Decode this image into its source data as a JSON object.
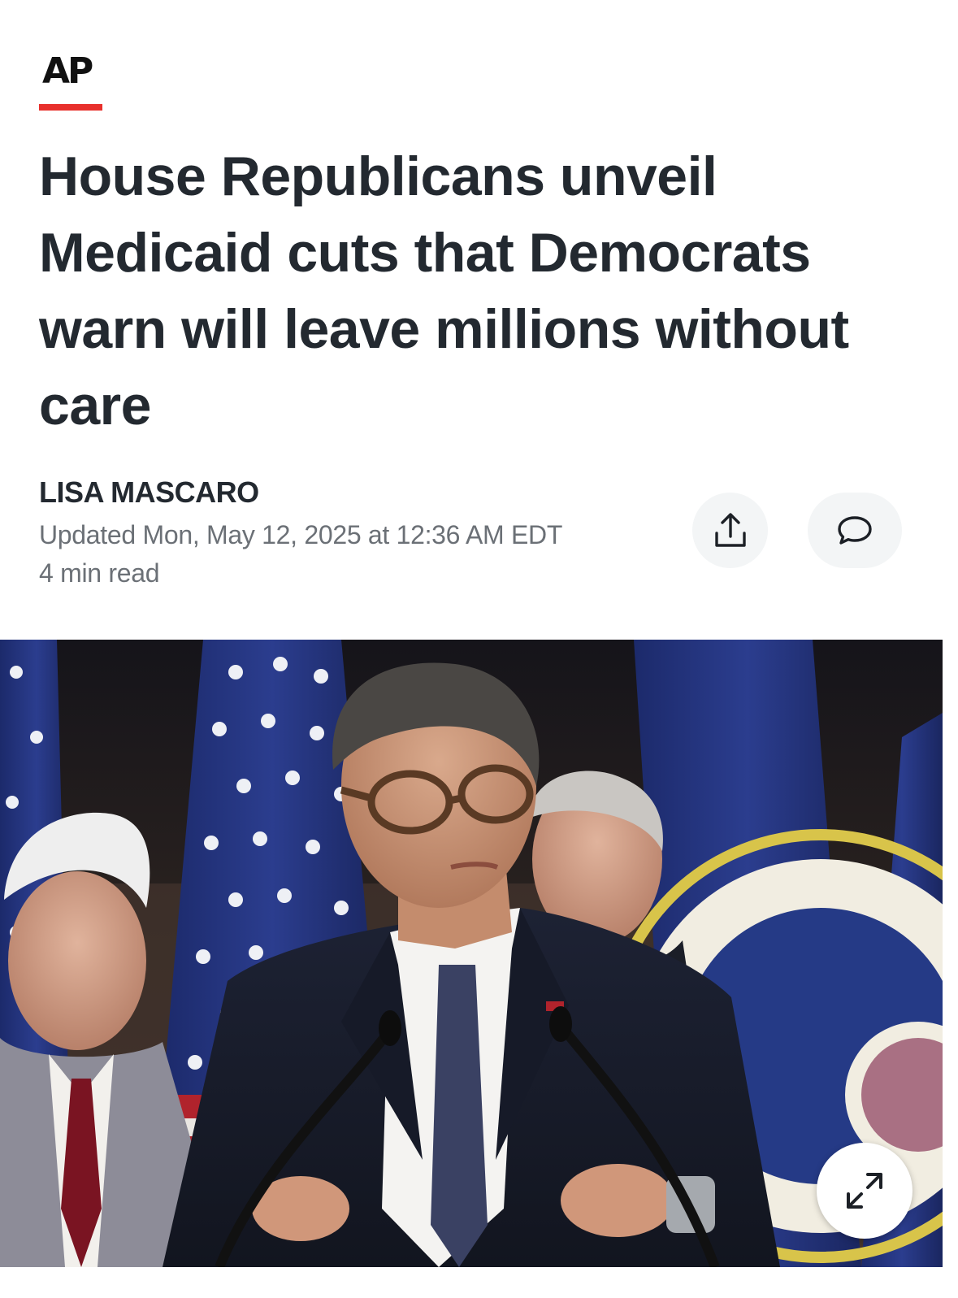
{
  "brand": {
    "logo_text": "AP",
    "accent_color": "#e8302c"
  },
  "article": {
    "headline": "House Republicans unveil Medicaid cuts that Democrats warn will leave millions without care",
    "author": "LISA MASCARO",
    "updated": "Updated Mon, May 12, 2025 at 12:36 AM EDT",
    "read_time": "4 min read"
  },
  "actions": {
    "share_icon": "share-icon",
    "comment_icon": "comment-icon",
    "expand_icon": "expand-icon"
  },
  "photo": {
    "icon": "photo-press-conference"
  }
}
